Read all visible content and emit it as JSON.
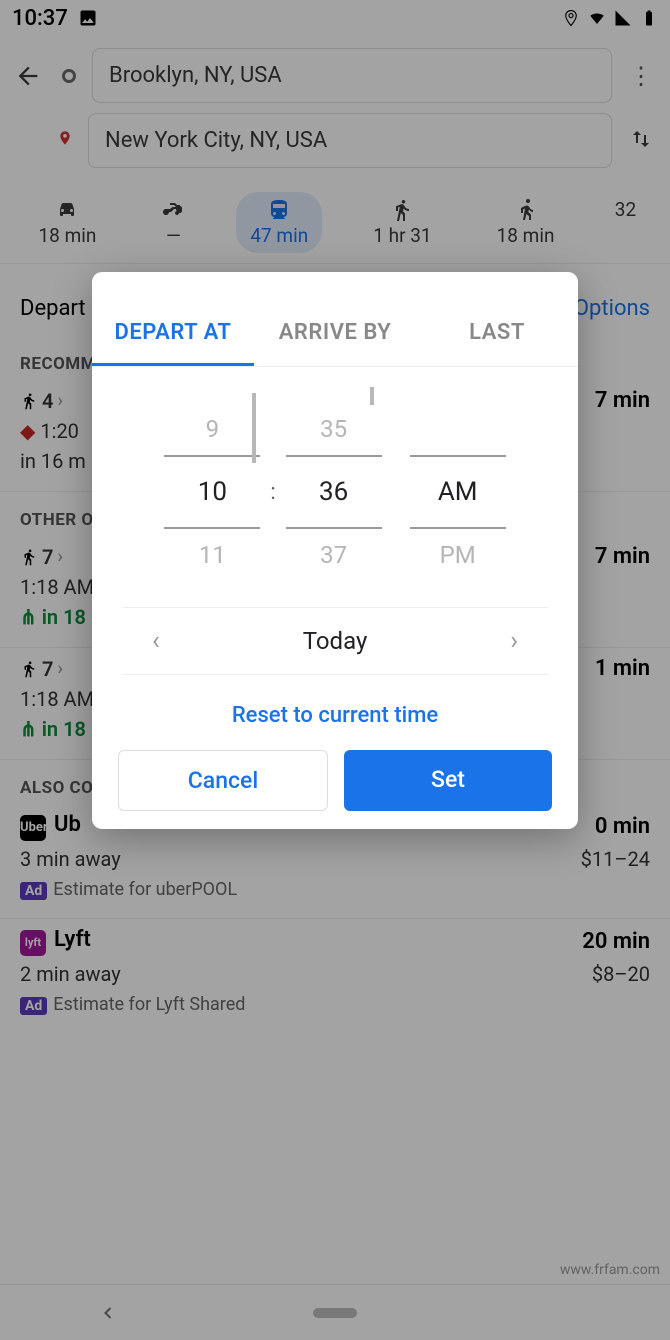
{
  "status": {
    "time": "10:37"
  },
  "search": {
    "origin": "Brooklyn, NY, USA",
    "destination": "New York City, NY, USA"
  },
  "modes": {
    "car": "18 min",
    "moto": "—",
    "transit": "47 min",
    "walk": "1 hr 31",
    "ride": "18 min",
    "bike_partial": "32"
  },
  "options_row": {
    "left": "Depart a",
    "right": "Options"
  },
  "sections": {
    "recommended": "RECOMM",
    "other": "OTHER O",
    "also": "ALSO CO"
  },
  "items": {
    "r1": {
      "steps": "4",
      "dur": "7 min",
      "warn": "1:20",
      "sub": "in 16 m"
    },
    "o1": {
      "steps": "7",
      "dur": "7 min",
      "time": "1:18 AM",
      "live": "in 18"
    },
    "o2": {
      "steps": "7",
      "dur": "1 min",
      "time": "1:18 AM",
      "live": "in 18"
    },
    "uber": {
      "name": "Ub",
      "dur": "0 min",
      "away": "3 min away",
      "price": "$11–24",
      "ad": "Estimate for uberPOOL"
    },
    "lyft": {
      "name": "Lyft",
      "dur": "20 min",
      "away": "2 min away",
      "price": "$8–20",
      "ad": "Estimate for Lyft Shared"
    }
  },
  "dialog": {
    "tabs": {
      "depart": "DEPART AT",
      "arrive": "ARRIVE BY",
      "last": "LAST"
    },
    "picker": {
      "hour_prev": "9",
      "hour": "10",
      "hour_next": "11",
      "min_prev": "35",
      "min": "36",
      "min_next": "37",
      "ampm": "AM",
      "ampm_next": "PM"
    },
    "date": "Today",
    "reset": "Reset to current time",
    "cancel": "Cancel",
    "set": "Set"
  },
  "watermark": "www.frfam.com"
}
